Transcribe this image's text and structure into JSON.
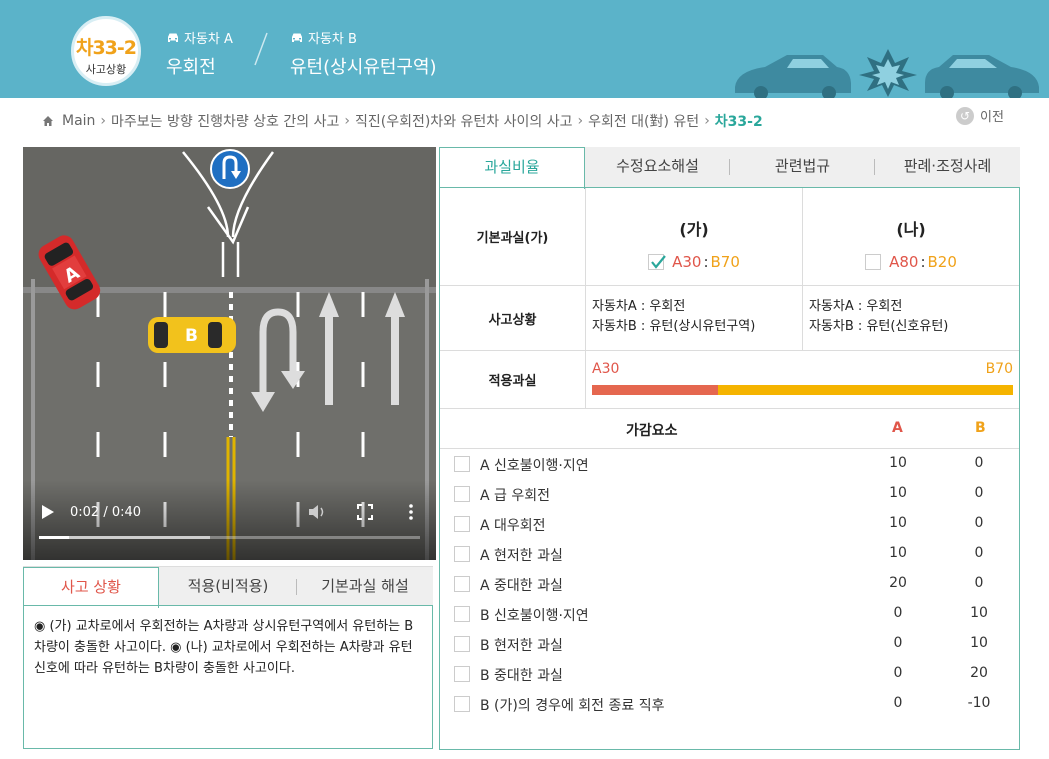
{
  "header": {
    "badge_code": "차33-2",
    "badge_sub": "사고상황",
    "vehicle_a_label": "자동차 A",
    "vehicle_a_value": "우회전",
    "vehicle_b_label": "자동차 B",
    "vehicle_b_value": "유턴(상시유턴구역)"
  },
  "breadcrumb": {
    "items": [
      "Main",
      "마주보는 방향 진행차량 상호 간의 사고",
      "직진(우회전)차와 유턴차 사이의 사고",
      "우회전 대(對) 유턴"
    ],
    "current": "차33-2",
    "prev_label": "이전"
  },
  "video": {
    "car_a_letter": "A",
    "car_b_letter": "B",
    "time": "0:02 / 0:40",
    "progress": 0.08,
    "buffered": 0.45
  },
  "left_tabs": {
    "items": [
      "사고 상황",
      "적용(비적용)",
      "기본과실 해설"
    ],
    "active": 0,
    "content": "◉ (가) 교차로에서 우회전하는 A차량과 상시유턴구역에서 유턴하는 B차량이 충돌한 사고이다. ◉ (나) 교차로에서 우회전하는 A차량과 유턴신호에 따라 유턴하는 B차량이 충돌한 사고이다."
  },
  "right_tabs": {
    "items": [
      "과실비율",
      "수정요소해설",
      "관련법규",
      "판례·조정사례"
    ],
    "active": 0
  },
  "basic_fault": {
    "label": "기본과실(가)",
    "options": [
      {
        "title": "(가)",
        "a": "A30",
        "b": "B70",
        "checked": true
      },
      {
        "title": "(나)",
        "a": "A80",
        "b": "B20",
        "checked": false
      }
    ]
  },
  "situation": {
    "label": "사고상황",
    "ga_line1": "자동차A : 우회전",
    "ga_line2": "자동차B : 유턴(상시유턴구역)",
    "na_line1": "자동차A : 우회전",
    "na_line2": "자동차B : 유턴(신호유턴)"
  },
  "applied": {
    "label": "적용과실",
    "a_label": "A30",
    "b_label": "B70",
    "a_percent": 30
  },
  "modifiers": {
    "title": "가감요소",
    "col_a": "A",
    "col_b": "B",
    "rows": [
      {
        "label": "A 신호불이행·지연",
        "a": "10",
        "b": "0"
      },
      {
        "label": "A 급 우회전",
        "a": "10",
        "b": "0"
      },
      {
        "label": "A 대우회전",
        "a": "10",
        "b": "0"
      },
      {
        "label": "A 현저한 과실",
        "a": "10",
        "b": "0"
      },
      {
        "label": "A 중대한 과실",
        "a": "20",
        "b": "0"
      },
      {
        "label": "B 신호불이행·지연",
        "a": "0",
        "b": "10"
      },
      {
        "label": "B 현저한 과실",
        "a": "0",
        "b": "10"
      },
      {
        "label": "B 중대한 과실",
        "a": "0",
        "b": "20"
      },
      {
        "label": "B (가)의 경우에 회전 종료 직후",
        "a": "0",
        "b": "-10"
      }
    ]
  },
  "colors": {
    "header_bg": "#5bb3c9",
    "accent_teal": "#2aa79b",
    "party_a": "#e0564a",
    "party_b": "#f0a21a"
  }
}
